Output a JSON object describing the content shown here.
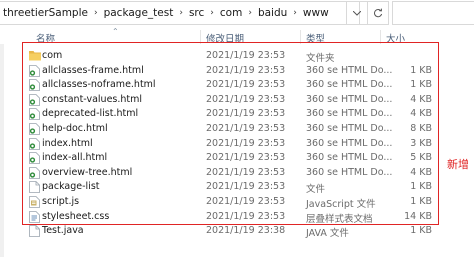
{
  "breadcrumb": [
    "threetierSample",
    "package_test",
    "src",
    "com",
    "baidu",
    "www"
  ],
  "columns": {
    "name": "名称",
    "date": "修改日期",
    "type": "类型",
    "size": "大小"
  },
  "files": [
    {
      "name": "com",
      "date": "2021/1/19 23:53",
      "type": "文件夹",
      "size": "",
      "icon": "folder-icon"
    },
    {
      "name": "allclasses-frame.html",
      "date": "2021/1/19 23:53",
      "type": "360 se HTML Do...",
      "size": "1 KB",
      "icon": "html-file-icon"
    },
    {
      "name": "allclasses-noframe.html",
      "date": "2021/1/19 23:53",
      "type": "360 se HTML Do...",
      "size": "1 KB",
      "icon": "html-file-icon"
    },
    {
      "name": "constant-values.html",
      "date": "2021/1/19 23:53",
      "type": "360 se HTML Do...",
      "size": "4 KB",
      "icon": "html-file-icon"
    },
    {
      "name": "deprecated-list.html",
      "date": "2021/1/19 23:53",
      "type": "360 se HTML Do...",
      "size": "4 KB",
      "icon": "html-file-icon"
    },
    {
      "name": "help-doc.html",
      "date": "2021/1/19 23:53",
      "type": "360 se HTML Do...",
      "size": "8 KB",
      "icon": "html-file-icon"
    },
    {
      "name": "index.html",
      "date": "2021/1/19 23:53",
      "type": "360 se HTML Do...",
      "size": "3 KB",
      "icon": "html-file-icon"
    },
    {
      "name": "index-all.html",
      "date": "2021/1/19 23:53",
      "type": "360 se HTML Do...",
      "size": "5 KB",
      "icon": "html-file-icon"
    },
    {
      "name": "overview-tree.html",
      "date": "2021/1/19 23:53",
      "type": "360 se HTML Do...",
      "size": "4 KB",
      "icon": "html-file-icon"
    },
    {
      "name": "package-list",
      "date": "2021/1/19 23:53",
      "type": "文件",
      "size": "1 KB",
      "icon": "plain-file-icon"
    },
    {
      "name": "script.js",
      "date": "2021/1/19 23:53",
      "type": "JavaScript 文件",
      "size": "1 KB",
      "icon": "script-file-icon"
    },
    {
      "name": "stylesheet.css",
      "date": "2021/1/19 23:53",
      "type": "层叠样式表文档",
      "size": "14 KB",
      "icon": "css-file-icon"
    },
    {
      "name": "Test.java",
      "date": "2021/1/19 23:38",
      "type": "JAVA 文件",
      "size": "1 KB",
      "icon": "plain-file-icon"
    }
  ],
  "annotation": "新增",
  "colors": {
    "highlight": "#e02424",
    "folder": "#e8b74a"
  }
}
